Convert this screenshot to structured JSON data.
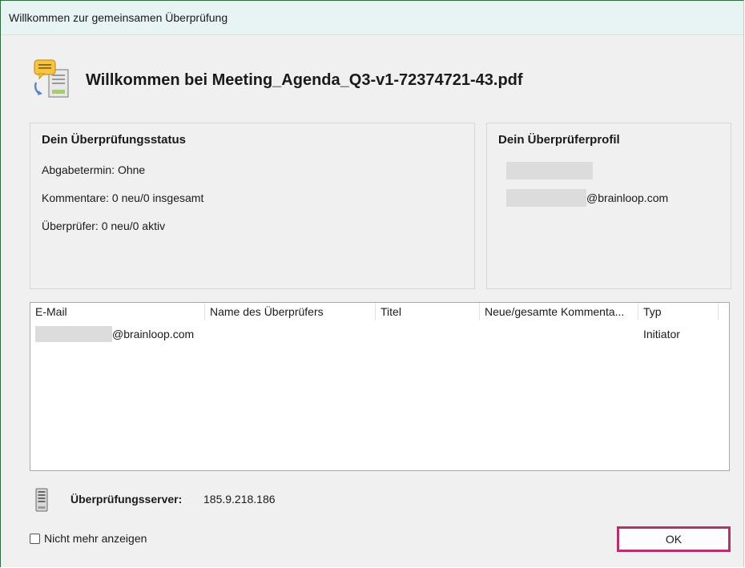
{
  "window": {
    "title": "Willkommen zur gemeinsamen Überprüfung"
  },
  "header": {
    "title": "Willkommen bei Meeting_Agenda_Q3-v1-72374721-43.pdf",
    "icon": "review-document-icon"
  },
  "status_panel": {
    "heading": "Dein Überprüfungsstatus",
    "deadline": "Abgabetermin: Ohne",
    "comments": "Kommentare: 0 neu/0 insgesamt",
    "reviewers": "Überprüfer: 0 neu/0 aktiv"
  },
  "profile_panel": {
    "heading": "Dein Überprüferprofil",
    "email_domain": "@brainloop.com"
  },
  "table": {
    "columns": [
      "E-Mail",
      "Name des Überprüfers",
      "Titel",
      "Neue/gesamte Kommenta...",
      "Typ"
    ],
    "rows": [
      {
        "email_domain": "@brainloop.com",
        "name": "",
        "title": "",
        "comments": "",
        "type": "Initiator"
      }
    ]
  },
  "server": {
    "label": "Überprüfungsserver:",
    "value": "185.9.218.186",
    "icon": "server-icon"
  },
  "footer": {
    "checkbox_label": "Nicht mehr anzeigen",
    "checkbox_checked": false,
    "ok_label": "OK"
  },
  "colors": {
    "ok_highlight": "#b5316e",
    "titlebar_bg": "#e8f4f4",
    "dialog_bg": "#f0f0f0"
  }
}
